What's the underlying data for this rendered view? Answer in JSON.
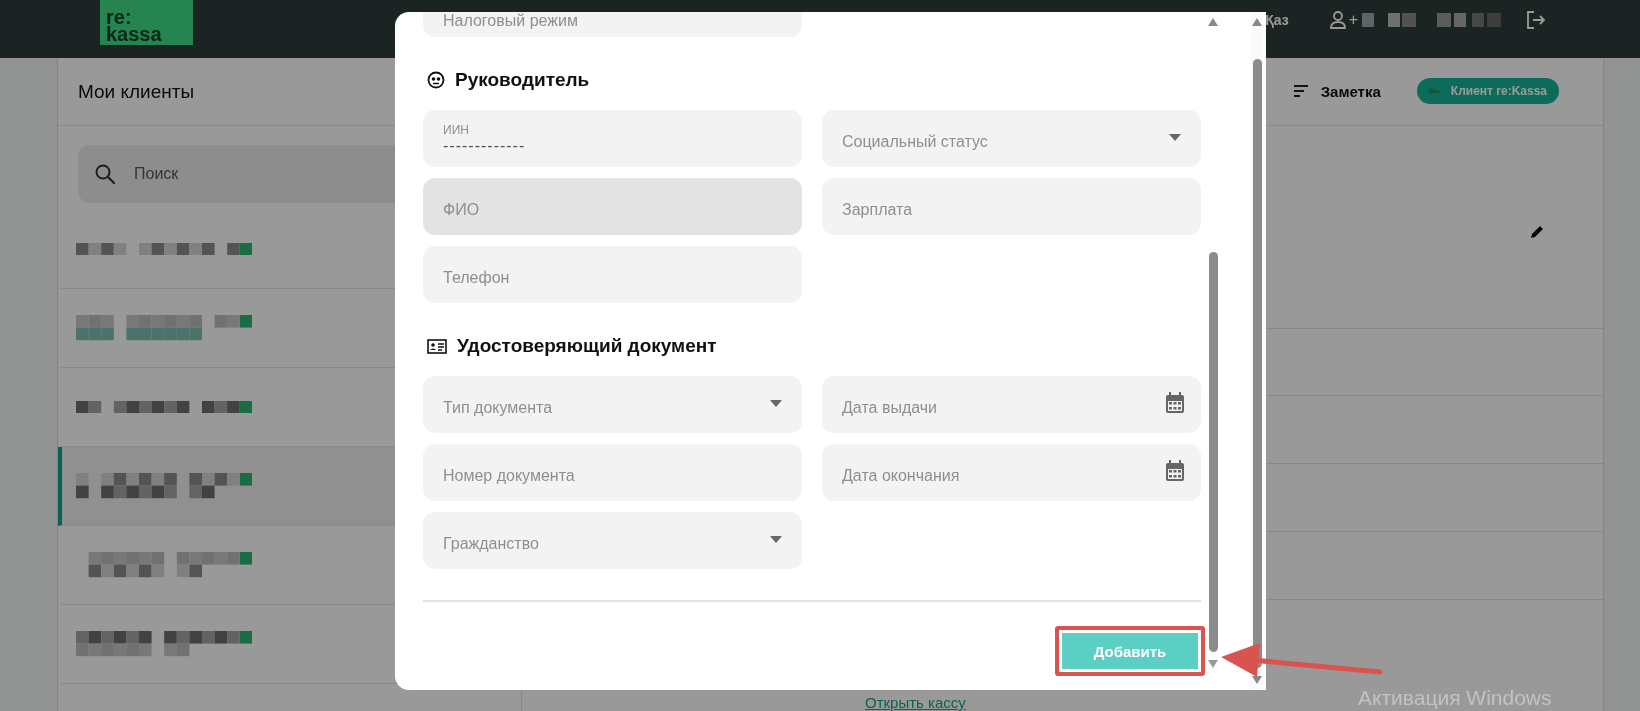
{
  "header": {
    "logo_top": "re:",
    "logo_bottom": "kassa",
    "language": {
      "label": "Қаз",
      "selected": true
    },
    "phone_prefix": "+"
  },
  "clients_panel": {
    "title": "Мои клиенты",
    "search": {
      "placeholder": "Поиск"
    },
    "items": [
      {
        "selected": false
      },
      {
        "selected": false
      },
      {
        "selected": false
      },
      {
        "selected": true
      },
      {
        "selected": false
      },
      {
        "selected": false
      }
    ]
  },
  "detail_panel": {
    "note_button": "Заметка",
    "client_badge": "Клиент re:Kassa",
    "open_register_link": "Открыть кассу"
  },
  "modal": {
    "top_field": {
      "placeholder": "Налоговый режим"
    },
    "sections": [
      {
        "title": "Руководитель",
        "kind": "person",
        "fields": [
          {
            "kind": "text",
            "label": "ИИН",
            "value": "-------------",
            "disabled": false
          },
          {
            "kind": "select",
            "placeholder": "Социальный статус",
            "disabled": false
          },
          {
            "kind": "text",
            "placeholder": "ФИО",
            "disabled": true
          },
          {
            "kind": "text",
            "placeholder": "Зарплата",
            "disabled": false
          },
          {
            "kind": "text",
            "placeholder": "Телефон",
            "disabled": false
          }
        ]
      },
      {
        "title": "Удостоверяющий документ",
        "kind": "document",
        "fields": [
          {
            "kind": "select",
            "placeholder": "Тип документа",
            "disabled": false
          },
          {
            "kind": "date",
            "placeholder": "Дата выдачи",
            "disabled": false
          },
          {
            "kind": "text",
            "placeholder": "Номер документа",
            "disabled": false
          },
          {
            "kind": "date",
            "placeholder": "Дата окончания",
            "disabled": false
          },
          {
            "kind": "select",
            "placeholder": "Гражданство",
            "disabled": false
          }
        ]
      }
    ],
    "submit": "Добавить"
  },
  "os_watermark": "Активация Windows"
}
